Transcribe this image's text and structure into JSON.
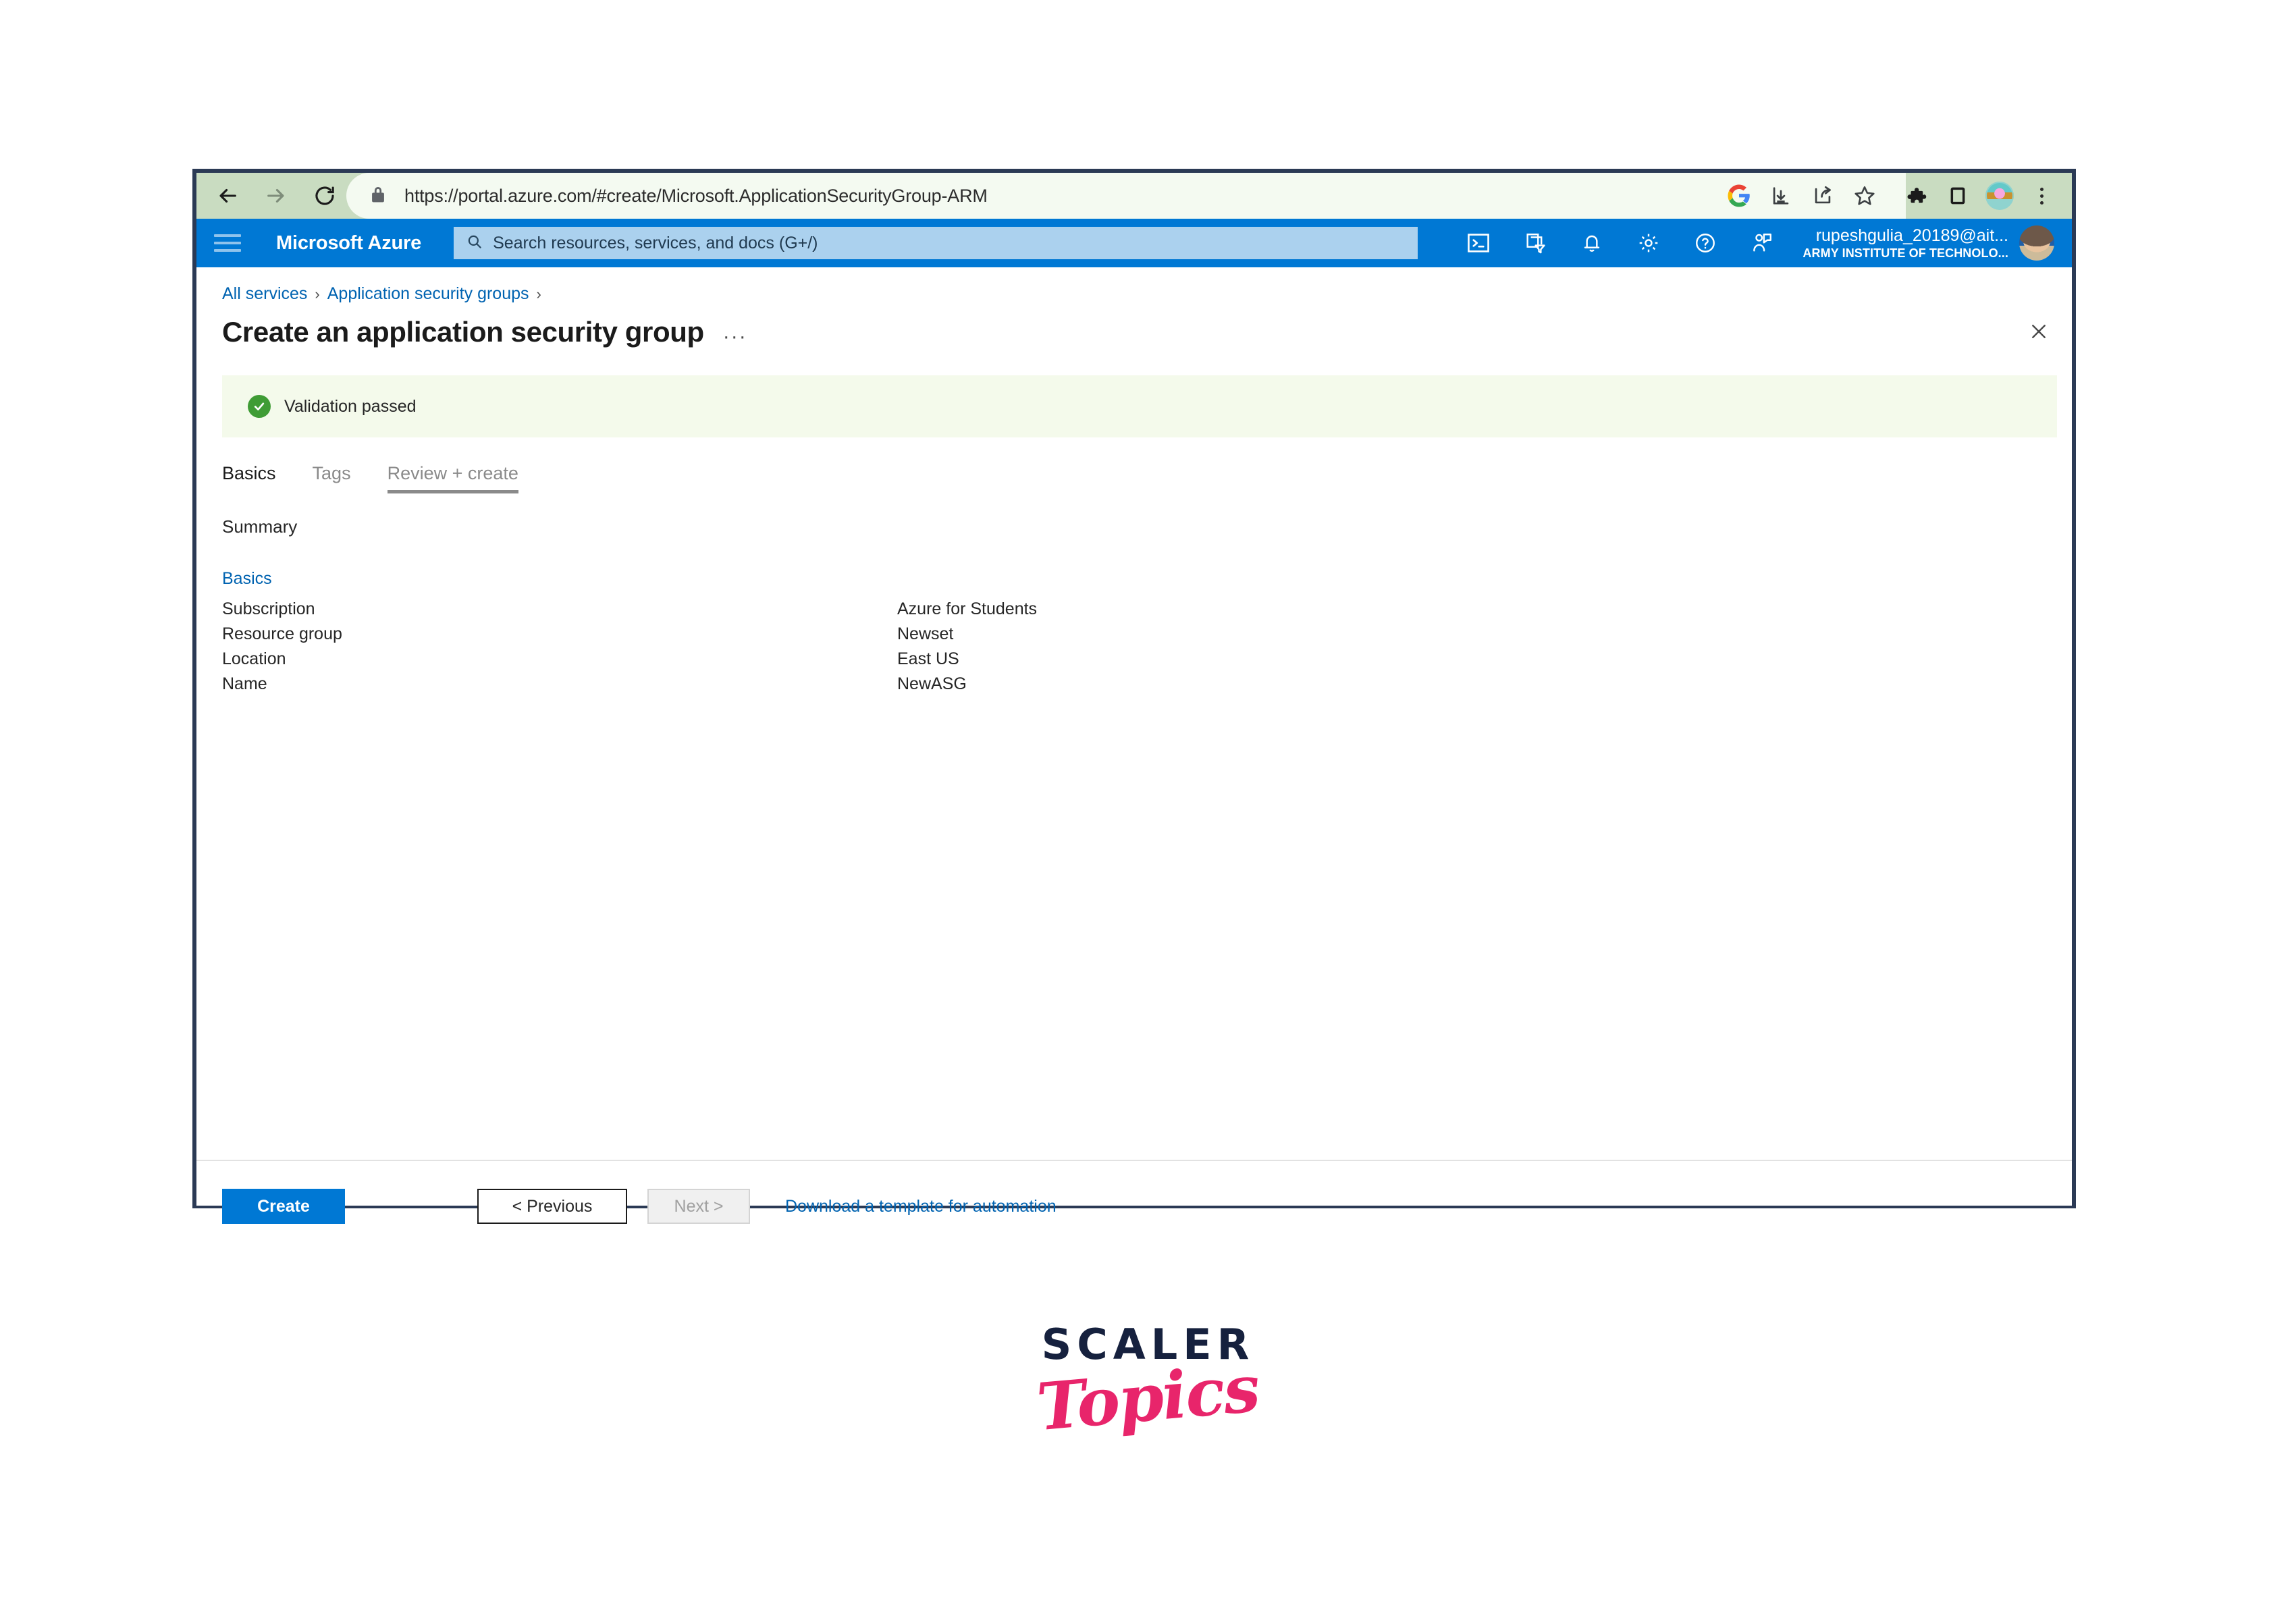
{
  "browser": {
    "back_icon": "back-arrow-icon",
    "forward_icon": "forward-arrow-icon",
    "reload_icon": "reload-icon",
    "lock_icon": "lock-icon",
    "url": "https://portal.azure.com/#create/Microsoft.ApplicationSecurityGroup-ARM",
    "right_icons": [
      {
        "name": "google-account-icon",
        "label": "G"
      },
      {
        "name": "download-icon",
        "label": ""
      },
      {
        "name": "share-icon",
        "label": ""
      },
      {
        "name": "bookmark-star-icon",
        "label": ""
      },
      {
        "name": "extensions-puzzle-icon",
        "label": ""
      },
      {
        "name": "sidebar-panel-icon",
        "label": ""
      },
      {
        "name": "profile-avatar-icon",
        "label": ""
      },
      {
        "name": "chrome-menu-icon",
        "label": ""
      }
    ],
    "toolbar_bg": "#c9dcc1",
    "frame_color": "#2b3a55"
  },
  "azure_header": {
    "menu_icon": "hamburger-menu-icon",
    "brand": "Microsoft Azure",
    "search_placeholder": "Search resources, services, and docs (G+/)",
    "search_icon": "search-icon",
    "icons": [
      {
        "name": "cloud-shell-icon"
      },
      {
        "name": "directories-subscriptions-icon"
      },
      {
        "name": "notifications-bell-icon"
      },
      {
        "name": "settings-gear-icon"
      },
      {
        "name": "help-question-icon"
      },
      {
        "name": "feedback-icon"
      }
    ],
    "account_name": "rupeshgulia_20189@ait...",
    "account_org": "ARMY INSTITUTE OF TECHNOLO...",
    "avatar": "user-avatar",
    "bg_color": "#0078d4",
    "search_bg": "#abd1ee"
  },
  "breadcrumb": {
    "items": [
      {
        "label": "All services"
      },
      {
        "label": "Application security groups"
      }
    ],
    "separator": "›",
    "trailing_separator": "›",
    "link_color": "#0063b1"
  },
  "page": {
    "title": "Create an application security group",
    "title_ellipsis": "···",
    "close_icon": "close-x-icon"
  },
  "validation": {
    "icon": "check-circle-icon",
    "message": "Validation passed",
    "bg_color": "#f4faeb",
    "icon_color": "#3f9c35"
  },
  "tabs": [
    {
      "label": "Basics",
      "state": "normal"
    },
    {
      "label": "Tags",
      "state": "muted"
    },
    {
      "label": "Review + create",
      "state": "active"
    }
  ],
  "summary": {
    "label": "Summary",
    "section_heading": "Basics",
    "rows": [
      {
        "key": "Subscription",
        "value": "Azure for Students"
      },
      {
        "key": "Resource group",
        "value": "Newset"
      },
      {
        "key": "Location",
        "value": "East US"
      },
      {
        "key": "Name",
        "value": "NewASG"
      }
    ]
  },
  "footer": {
    "create_label": "Create",
    "previous_label": "< Previous",
    "next_label": "Next >",
    "download_link": "Download a template for automation",
    "create_color": "#0078d4",
    "link_color": "#0063b1"
  },
  "watermark": {
    "primary": "SCALER",
    "secondary": "Topics",
    "primary_color": "#16213e",
    "secondary_color": "#e8256b"
  }
}
